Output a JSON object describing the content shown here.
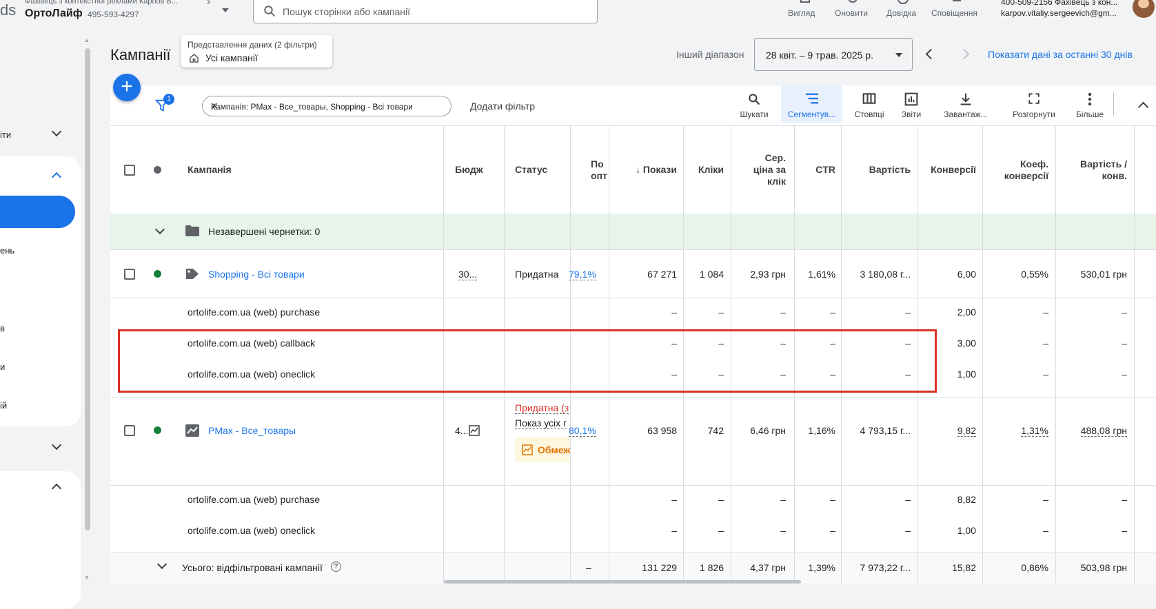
{
  "topbar": {
    "brand_fragment": "ds",
    "account_sub": "Фахівець з контекстної реклами Карпов В...",
    "account_name": "ОртоЛайф",
    "account_id": "495-593-4297",
    "search_placeholder": "Пошук сторінки або кампанії",
    "buttons": [
      "Вигляд",
      "Оновити",
      "Довідка",
      "Сповіщення"
    ],
    "user_line1": "400-509-2156 Фахівець з кон...",
    "user_line2": "karpov.vitaliy.sergeevich@gm..."
  },
  "sidebar": {
    "items": [
      "іти",
      "ень",
      "в",
      "и",
      "ій"
    ]
  },
  "header": {
    "title": "Кампанії",
    "view_label": "Представлення даних (2 фільтри)",
    "view_value": "Усі кампанії",
    "range_label": "Інший діапазон",
    "date_range": "28 квіт. – 9 трав. 2025 р.",
    "show_last_30": "Показати дані за останні 30 днів"
  },
  "toolbar": {
    "filter_count": "1",
    "filter_chip": "Кампанія: PMax - Все_товары, Shopping - Всі товари",
    "add_filter": "Додати фільтр",
    "tools": [
      "Шукати",
      "Сегментув...",
      "Стовпці",
      "Звіти",
      "Завантаж...",
      "Розгорнути",
      "Більше"
    ]
  },
  "table": {
    "columns": {
      "campaign": "Кампанія",
      "budget": "Бюдж",
      "status": "Статус",
      "opt_1": "По",
      "opt_2": "опт",
      "impr": "↓ Покази",
      "clicks": "Кліки",
      "cpc_1": "Сер.",
      "cpc_2": "ціна за",
      "cpc_3": "клік",
      "ctr": "CTR",
      "cost": "Вартість",
      "conv": "Конверсії",
      "convrate_1": "Коеф.",
      "convrate_2": "конверсії",
      "costconv_1": "Вартість /",
      "costconv_2": "конв."
    },
    "drafts": "Незавершені чернетки: 0",
    "shopping": {
      "name": "Shopping - Всі товари",
      "budget": "30...",
      "status": "Придатна",
      "opt": "79,1%",
      "impr": "67 271",
      "clicks": "1 084",
      "cpc": "2,93 грн",
      "ctr": "1,61%",
      "cost": "3 180,08 г...",
      "conv": "6,00",
      "convrate": "0,55%",
      "costconv": "530,01 грн"
    },
    "shopping_seg": [
      {
        "name": "ortolife.com.ua (web) purchase",
        "conv": "2,00"
      },
      {
        "name": "ortolife.com.ua (web) callback",
        "conv": "3,00"
      },
      {
        "name": "ortolife.com.ua (web) oneclick",
        "conv": "1,00"
      }
    ],
    "pmax": {
      "name": "PMax - Все_товары",
      "budget": "4...",
      "status1": "Придатна (з",
      "status2": "Показ усіх г",
      "status3": "Обмеж",
      "opt": "80,1%",
      "impr": "63 958",
      "clicks": "742",
      "cpc": "6,46 грн",
      "ctr": "1,16%",
      "cost": "4 793,15 г...",
      "conv": "9,82",
      "convrate": "1,31%",
      "costconv": "488,08 грн"
    },
    "pmax_seg": [
      {
        "name": "ortolife.com.ua (web) purchase",
        "conv": "8,82"
      },
      {
        "name": "ortolife.com.ua (web) oneclick",
        "conv": "1,00"
      }
    ],
    "dash": "–",
    "total": {
      "label": "Усього: відфільтровані кампанії",
      "opt": "–",
      "impr": "131 229",
      "clicks": "1 826",
      "cpc": "4,37 грн",
      "ctr": "1,39%",
      "cost": "7 973,22 г...",
      "conv": "15,82",
      "convrate": "0,86%",
      "costconv": "503,98 грн"
    }
  }
}
